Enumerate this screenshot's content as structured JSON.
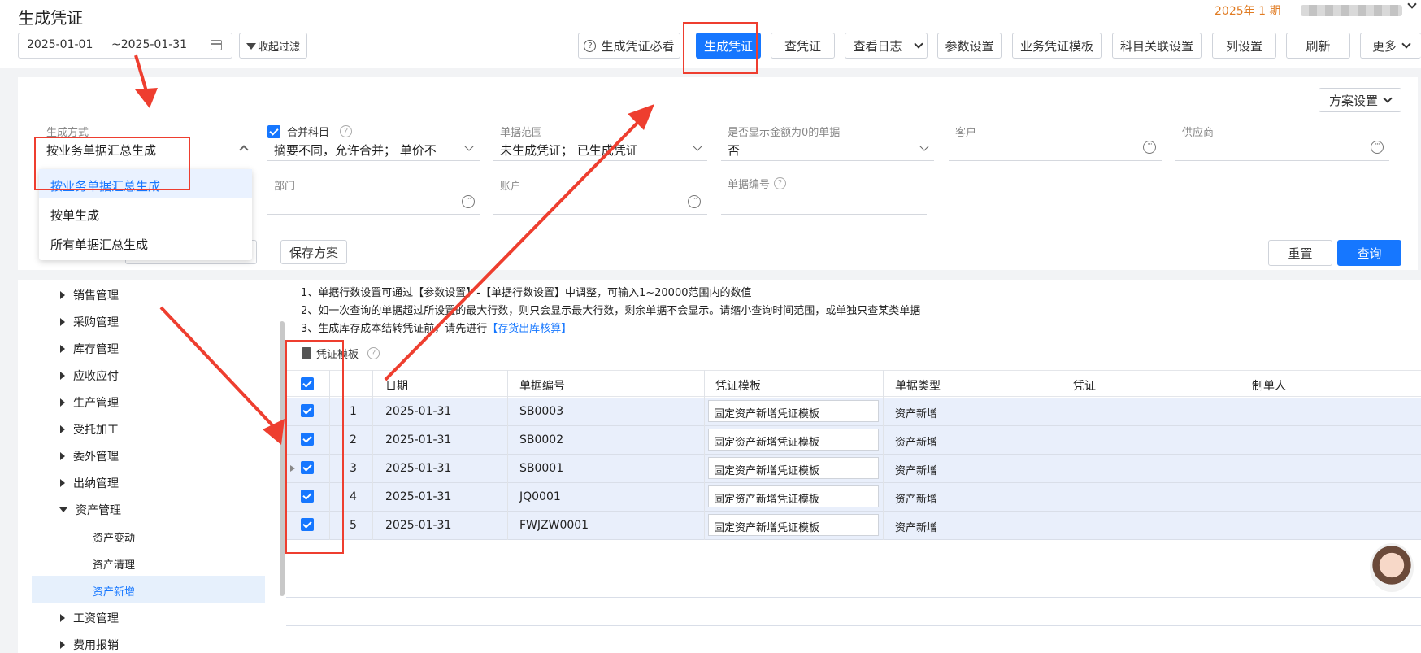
{
  "header": {
    "title": "生成凭证",
    "period": "2025年 1 期",
    "date_from": "2025-01-01",
    "date_to": "~2025-01-31",
    "filter_label": "收起过滤"
  },
  "toolbar": {
    "help": "生成凭证必看",
    "generate": "生成凭证",
    "view_voucher": "查凭证",
    "view_log": "查看日志",
    "params": "参数设置",
    "template": "业务凭证模板",
    "subject_link": "科目关联设置",
    "columns": "列设置",
    "refresh": "刷新",
    "more": "更多"
  },
  "filters": {
    "plan_settings": "方案设置",
    "gen_mode_label": "生成方式",
    "gen_mode_value": "按业务单据汇总生成",
    "merge_label": "合并科目",
    "merge_value": "摘要不同，允许合并；  单价不",
    "range_label": "单据范围",
    "range_value": "未生成凭证；  已生成凭证",
    "zero_label": "是否显示金额为0的单据",
    "zero_value": "否",
    "customer_label": "客户",
    "supplier_label": "供应商",
    "dept_label": "部门",
    "account_label": "账户",
    "docno_label": "单据编号",
    "save_plan": "保存方案",
    "reset": "重置",
    "query": "查询"
  },
  "dropdown": [
    "按业务单据汇总生成",
    "按单生成",
    "所有单据汇总生成"
  ],
  "tree": {
    "items": [
      "销售管理",
      "采购管理",
      "库存管理",
      "应收应付",
      "生产管理",
      "受托加工",
      "委外管理",
      "出纳管理",
      "资产管理"
    ],
    "sub": [
      "资产变动",
      "资产清理",
      "资产新增"
    ],
    "after": [
      "工资管理",
      "费用报销"
    ]
  },
  "notes": {
    "n1": "1、单据行数设置可通过【参数设置】-【单据行数设置】中调整，可输入1~20000范围内的数值",
    "n2": "2、如一次查询的单据超过所设置的最大行数，则只会显示最大行数，剩余单据不会显示。请缩小查询时间范围，或单独只查某类单据",
    "n3_pre": "3、生成库存成本结转凭证前，请先进行",
    "n3_link": "【存货出库核算】",
    "template_label": "凭证模板"
  },
  "table": {
    "headers": [
      "日期",
      "单据编号",
      "凭证模板",
      "单据类型",
      "凭证",
      "制单人"
    ],
    "rows": [
      {
        "idx": "1",
        "date": "2025-01-31",
        "no": "SB0003",
        "tpl": "固定资产新增凭证模板",
        "type": "资产新增"
      },
      {
        "idx": "2",
        "date": "2025-01-31",
        "no": "SB0002",
        "tpl": "固定资产新增凭证模板",
        "type": "资产新增"
      },
      {
        "idx": "3",
        "date": "2025-01-31",
        "no": "SB0001",
        "tpl": "固定资产新增凭证模板",
        "type": "资产新增"
      },
      {
        "idx": "4",
        "date": "2025-01-31",
        "no": "JQ0001",
        "tpl": "固定资产新增凭证模板",
        "type": "资产新增"
      },
      {
        "idx": "5",
        "date": "2025-01-31",
        "no": "FWJZW0001",
        "tpl": "固定资产新增凭证模板",
        "type": "资产新增"
      }
    ]
  },
  "colors": {
    "accent": "#1677ff",
    "annotation": "#ee3e2f",
    "period": "#e07b22"
  },
  "icons": [
    "calendar-icon",
    "funnel-icon",
    "help-circle-icon",
    "chevron-down-icon",
    "more-dots-icon",
    "document-icon",
    "caret-right-icon",
    "assistant-avatar"
  ]
}
